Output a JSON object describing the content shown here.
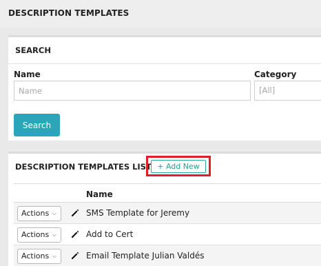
{
  "page": {
    "title": "DESCRIPTION TEMPLATES"
  },
  "search": {
    "title": "SEARCH",
    "name_label": "Name",
    "name_placeholder": "Name",
    "category_label": "Category",
    "category_value": "[All]",
    "search_button": "Search"
  },
  "list": {
    "title": "DESCRIPTION TEMPLATES LIST",
    "add_new_label": "+ Add New",
    "column_name": "Name",
    "actions_label": "Actions",
    "rows": [
      {
        "name": "SMS Template for Jeremy"
      },
      {
        "name": "Add to Cert"
      },
      {
        "name": "Email Template Julian Valdés"
      }
    ]
  },
  "colors": {
    "accent": "#2aa6b8",
    "add_new_green": "#25a08f",
    "highlight_red": "#dd1f2d"
  },
  "icons": {
    "edit": "pencil-icon",
    "dropdown": "chevron-down-icon"
  }
}
